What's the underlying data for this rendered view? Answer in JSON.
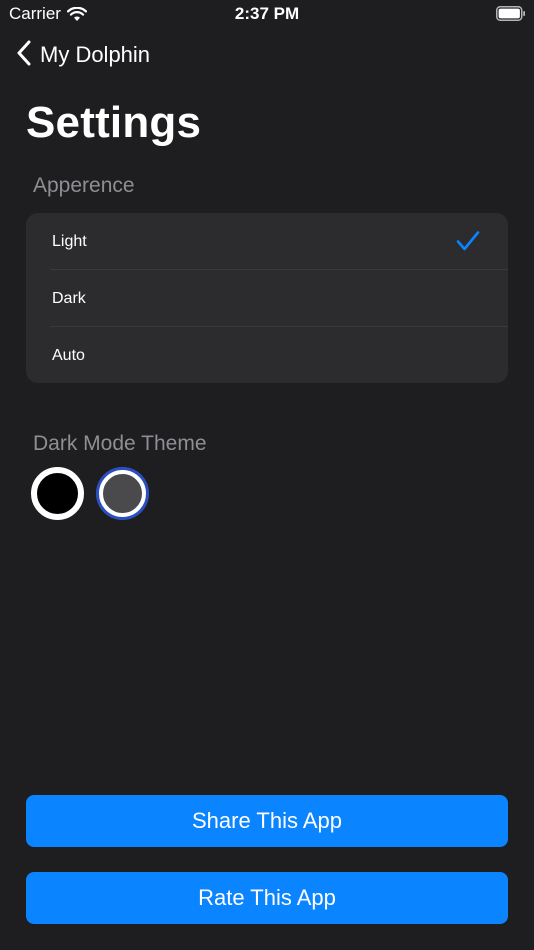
{
  "status_bar": {
    "carrier": "Carrier",
    "time": "2:37 PM"
  },
  "nav": {
    "back_label": "My Dolphin"
  },
  "page": {
    "title": "Settings"
  },
  "appearance": {
    "header": "Apperence",
    "options": [
      {
        "label": "Light",
        "selected": true
      },
      {
        "label": "Dark",
        "selected": false
      },
      {
        "label": "Auto",
        "selected": false
      }
    ]
  },
  "dark_mode_theme": {
    "header": "Dark Mode Theme",
    "swatches": [
      {
        "name": "black",
        "color": "#000000",
        "selected": false
      },
      {
        "name": "gray",
        "color": "#4a4a4c",
        "selected": true
      }
    ]
  },
  "buttons": {
    "share_label": "Share This App",
    "rate_label": "Rate This App"
  },
  "colors": {
    "accent": "#0a84ff",
    "background": "#1e1e20",
    "card": "#2c2c2e",
    "secondary_text": "#8e8e93"
  }
}
